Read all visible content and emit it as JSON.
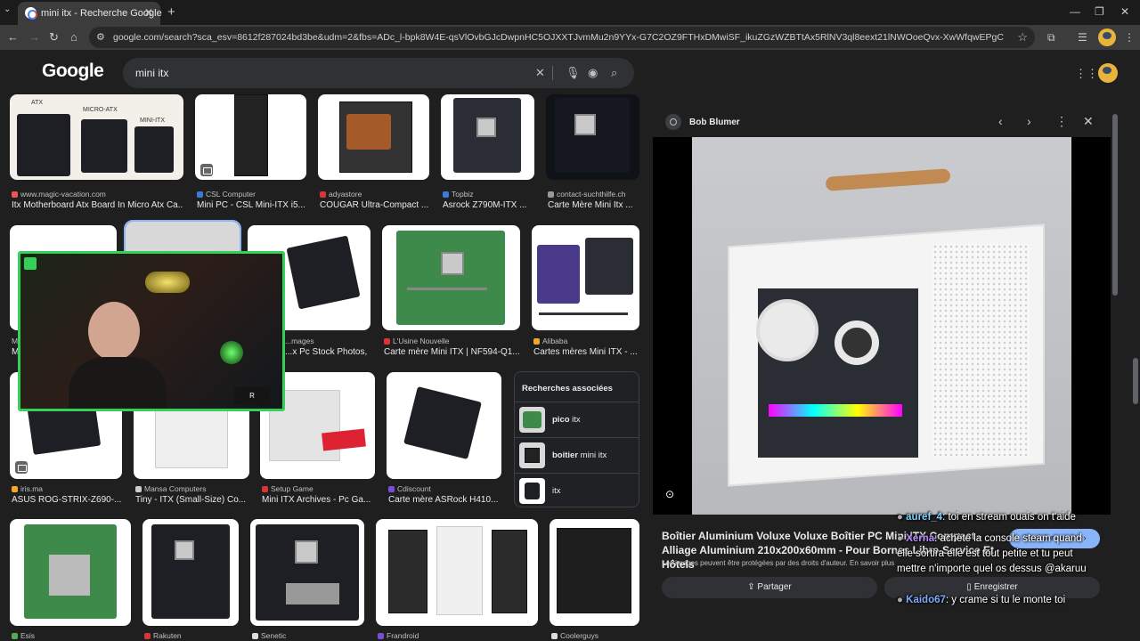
{
  "browser": {
    "tab_title": "mini itx - Recherche Google",
    "url": "google.com/search?sca_esv=8612f287024bd3be&udm=2&fbs=ADc_l-bpk8W4E-qsVlOvbGJcDwpnHC5OJXXTJvmMu2n9YYx-G7C2OZ9FTHxDMwiSF_ikuZGzWZBTtAx5RlNV3ql8eext21lNWOoeQvx-XwWfqwEPgC1u68z_m1QvL2V5MVLqLRZoKjaM..."
  },
  "google": {
    "logo": "Google",
    "query": "mini itx"
  },
  "grid": {
    "row1": [
      {
        "source": "www.magic-vacation.com",
        "caption": "Itx Motherboard Atx Board In Micro Atx Ca...",
        "labels": [
          "ATX",
          "MICRO-ATX",
          "MINI-ITX"
        ]
      },
      {
        "source": "CSL Computer",
        "caption": "Mini PC - CSL Mini-ITX i5..."
      },
      {
        "source": "adyastore",
        "caption": "COUGAR Ultra-Compact ..."
      },
      {
        "source": "Topbiz",
        "caption": "Asrock Z790M-ITX ..."
      },
      {
        "source": "contact-suchthilfe.ch",
        "caption": "Carte Mère Mini Itx ..."
      }
    ],
    "row2": [
      {
        "source": "M",
        "caption": "M"
      },
      {
        "source": "",
        "caption": ""
      },
      {
        "source": "...mages",
        "caption": "...x Pc Stock Photos, ..."
      },
      {
        "source": "L'Usine Nouvelle",
        "caption": "Carte mère Mini ITX | NF594-Q1..."
      },
      {
        "source": "Alibaba",
        "caption": "Cartes mères Mini ITX - ..."
      }
    ],
    "row3": [
      {
        "source": "iris.ma",
        "caption": "ASUS ROG-STRIX-Z690-..."
      },
      {
        "source": "Mansa Computers",
        "caption": "Tiny - ITX (Small-Size) Co..."
      },
      {
        "source": "Setup Game",
        "caption": "Mini ITX Archives - Pc Ga..."
      },
      {
        "source": "Cdiscount",
        "caption": "Carte mère ASRock H410..."
      }
    ],
    "row4": [
      {
        "source": "Esis"
      },
      {
        "source": "Rakuten"
      },
      {
        "source": "Senetic"
      },
      {
        "source": "Frandroid"
      },
      {
        "source": "Coolerguys"
      }
    ]
  },
  "related": {
    "title": "Recherches associées",
    "items": [
      {
        "bold": "pico",
        "rest": " itx"
      },
      {
        "bold": "boitier",
        "rest": " mini itx"
      },
      {
        "bold": "",
        "rest": "itx"
      }
    ]
  },
  "panel": {
    "source": "Bob Blumer",
    "title": "Boîtier Aluminium Voluxe Voluxe Boîtier PC Mini ITX Compact - Alliage Aluminium 210x200x60mm - Pour Bornes Libre-Service Et Hôtels",
    "note": "Les images peuvent être protégées par des droits d'auteur. En savoir plus",
    "visit_label": "Accéder au site",
    "share_label": "Partager",
    "save_label": "Enregistrer"
  },
  "chat": [
    {
      "user": "auref_4",
      "text": ": toi en stream ouais on t'aide",
      "color": "#7fd1ff"
    },
    {
      "user": "Xerna",
      "text": ": achète la console steam quand elle sortira elle est tout petite et tu peut mettre n'importe quel os dessus @akaruu",
      "color": "#b78cff"
    },
    {
      "user": "Kaido67",
      "text": ": y crame si tu le monte toi",
      "color": "#7fa8ff"
    }
  ],
  "colors": {
    "accent": "#8ab4f8",
    "webcam_border": "#34d058",
    "page_bg": "#1f1f1f"
  }
}
